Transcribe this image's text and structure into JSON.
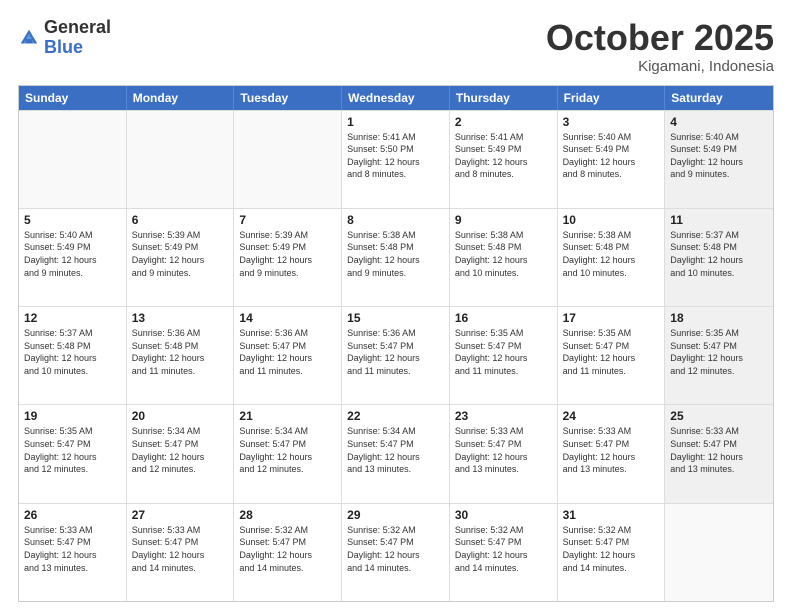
{
  "logo": {
    "general": "General",
    "blue": "Blue"
  },
  "title": "October 2025",
  "location": "Kigamani, Indonesia",
  "days": [
    "Sunday",
    "Monday",
    "Tuesday",
    "Wednesday",
    "Thursday",
    "Friday",
    "Saturday"
  ],
  "weeks": [
    [
      {
        "day": "",
        "content": "",
        "empty": true
      },
      {
        "day": "",
        "content": "",
        "empty": true
      },
      {
        "day": "",
        "content": "",
        "empty": true
      },
      {
        "day": "1",
        "content": "Sunrise: 5:41 AM\nSunset: 5:50 PM\nDaylight: 12 hours\nand 8 minutes.",
        "empty": false
      },
      {
        "day": "2",
        "content": "Sunrise: 5:41 AM\nSunset: 5:49 PM\nDaylight: 12 hours\nand 8 minutes.",
        "empty": false
      },
      {
        "day": "3",
        "content": "Sunrise: 5:40 AM\nSunset: 5:49 PM\nDaylight: 12 hours\nand 8 minutes.",
        "empty": false
      },
      {
        "day": "4",
        "content": "Sunrise: 5:40 AM\nSunset: 5:49 PM\nDaylight: 12 hours\nand 9 minutes.",
        "empty": false,
        "shaded": true
      }
    ],
    [
      {
        "day": "5",
        "content": "Sunrise: 5:40 AM\nSunset: 5:49 PM\nDaylight: 12 hours\nand 9 minutes.",
        "empty": false
      },
      {
        "day": "6",
        "content": "Sunrise: 5:39 AM\nSunset: 5:49 PM\nDaylight: 12 hours\nand 9 minutes.",
        "empty": false
      },
      {
        "day": "7",
        "content": "Sunrise: 5:39 AM\nSunset: 5:49 PM\nDaylight: 12 hours\nand 9 minutes.",
        "empty": false
      },
      {
        "day": "8",
        "content": "Sunrise: 5:38 AM\nSunset: 5:48 PM\nDaylight: 12 hours\nand 9 minutes.",
        "empty": false
      },
      {
        "day": "9",
        "content": "Sunrise: 5:38 AM\nSunset: 5:48 PM\nDaylight: 12 hours\nand 10 minutes.",
        "empty": false
      },
      {
        "day": "10",
        "content": "Sunrise: 5:38 AM\nSunset: 5:48 PM\nDaylight: 12 hours\nand 10 minutes.",
        "empty": false
      },
      {
        "day": "11",
        "content": "Sunrise: 5:37 AM\nSunset: 5:48 PM\nDaylight: 12 hours\nand 10 minutes.",
        "empty": false,
        "shaded": true
      }
    ],
    [
      {
        "day": "12",
        "content": "Sunrise: 5:37 AM\nSunset: 5:48 PM\nDaylight: 12 hours\nand 10 minutes.",
        "empty": false
      },
      {
        "day": "13",
        "content": "Sunrise: 5:36 AM\nSunset: 5:48 PM\nDaylight: 12 hours\nand 11 minutes.",
        "empty": false
      },
      {
        "day": "14",
        "content": "Sunrise: 5:36 AM\nSunset: 5:47 PM\nDaylight: 12 hours\nand 11 minutes.",
        "empty": false
      },
      {
        "day": "15",
        "content": "Sunrise: 5:36 AM\nSunset: 5:47 PM\nDaylight: 12 hours\nand 11 minutes.",
        "empty": false
      },
      {
        "day": "16",
        "content": "Sunrise: 5:35 AM\nSunset: 5:47 PM\nDaylight: 12 hours\nand 11 minutes.",
        "empty": false
      },
      {
        "day": "17",
        "content": "Sunrise: 5:35 AM\nSunset: 5:47 PM\nDaylight: 12 hours\nand 11 minutes.",
        "empty": false
      },
      {
        "day": "18",
        "content": "Sunrise: 5:35 AM\nSunset: 5:47 PM\nDaylight: 12 hours\nand 12 minutes.",
        "empty": false,
        "shaded": true
      }
    ],
    [
      {
        "day": "19",
        "content": "Sunrise: 5:35 AM\nSunset: 5:47 PM\nDaylight: 12 hours\nand 12 minutes.",
        "empty": false
      },
      {
        "day": "20",
        "content": "Sunrise: 5:34 AM\nSunset: 5:47 PM\nDaylight: 12 hours\nand 12 minutes.",
        "empty": false
      },
      {
        "day": "21",
        "content": "Sunrise: 5:34 AM\nSunset: 5:47 PM\nDaylight: 12 hours\nand 12 minutes.",
        "empty": false
      },
      {
        "day": "22",
        "content": "Sunrise: 5:34 AM\nSunset: 5:47 PM\nDaylight: 12 hours\nand 13 minutes.",
        "empty": false
      },
      {
        "day": "23",
        "content": "Sunrise: 5:33 AM\nSunset: 5:47 PM\nDaylight: 12 hours\nand 13 minutes.",
        "empty": false
      },
      {
        "day": "24",
        "content": "Sunrise: 5:33 AM\nSunset: 5:47 PM\nDaylight: 12 hours\nand 13 minutes.",
        "empty": false
      },
      {
        "day": "25",
        "content": "Sunrise: 5:33 AM\nSunset: 5:47 PM\nDaylight: 12 hours\nand 13 minutes.",
        "empty": false,
        "shaded": true
      }
    ],
    [
      {
        "day": "26",
        "content": "Sunrise: 5:33 AM\nSunset: 5:47 PM\nDaylight: 12 hours\nand 13 minutes.",
        "empty": false
      },
      {
        "day": "27",
        "content": "Sunrise: 5:33 AM\nSunset: 5:47 PM\nDaylight: 12 hours\nand 14 minutes.",
        "empty": false
      },
      {
        "day": "28",
        "content": "Sunrise: 5:32 AM\nSunset: 5:47 PM\nDaylight: 12 hours\nand 14 minutes.",
        "empty": false
      },
      {
        "day": "29",
        "content": "Sunrise: 5:32 AM\nSunset: 5:47 PM\nDaylight: 12 hours\nand 14 minutes.",
        "empty": false
      },
      {
        "day": "30",
        "content": "Sunrise: 5:32 AM\nSunset: 5:47 PM\nDaylight: 12 hours\nand 14 minutes.",
        "empty": false
      },
      {
        "day": "31",
        "content": "Sunrise: 5:32 AM\nSunset: 5:47 PM\nDaylight: 12 hours\nand 14 minutes.",
        "empty": false
      },
      {
        "day": "",
        "content": "",
        "empty": true,
        "shaded": true
      }
    ]
  ]
}
